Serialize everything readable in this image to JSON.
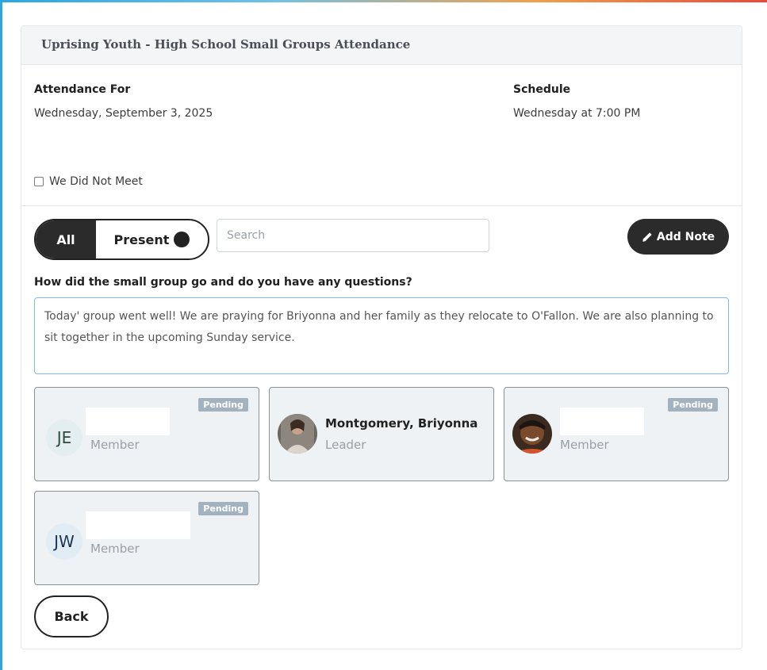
{
  "header": {
    "title": "Uprising Youth - High School Small Groups Attendance"
  },
  "attendance": {
    "label": "Attendance For",
    "date": "Wednesday, September 3, 2025"
  },
  "schedule": {
    "label": "Schedule",
    "value": "Wednesday at 7:00 PM"
  },
  "did_not_meet": {
    "label": "We Did Not Meet",
    "checked": false
  },
  "filter": {
    "all_label": "All",
    "present_label": "Present",
    "active": "All"
  },
  "search": {
    "placeholder": "Search",
    "value": ""
  },
  "add_note": {
    "label": "Add Note"
  },
  "notes": {
    "question": "How did the small group go and do you have any questions?",
    "text": "Today' group went well! We are praying for Briyonna and her family as they relocate to O'Fallon. We are also planning to sit together in the upcoming Sunday service."
  },
  "members": [
    {
      "initials": "JE",
      "name": "",
      "role": "Member",
      "badge": "Pending"
    },
    {
      "initials": "",
      "name": "Montgomery, Briyonna",
      "role": "Leader",
      "badge": ""
    },
    {
      "initials": "",
      "name": "",
      "role": "Member",
      "badge": "Pending"
    },
    {
      "initials": "JW",
      "name": "",
      "role": "Member",
      "badge": "Pending"
    }
  ],
  "back": {
    "label": "Back"
  },
  "colors": {
    "dark": "#2b2b2b",
    "card_bg": "#eef2f5",
    "badge": "#a3b2bf",
    "focus_border": "#7dbbe6"
  }
}
